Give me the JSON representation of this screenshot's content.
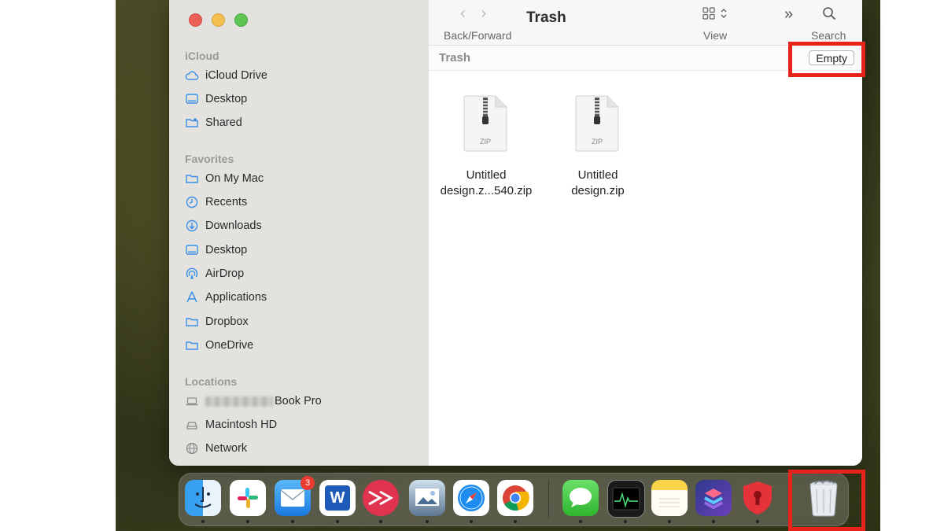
{
  "window": {
    "title": "Trash",
    "toolbar": {
      "back_forward_label": "Back/Forward",
      "view_label": "View",
      "search_label": "Search"
    },
    "pathbar": {
      "title": "Trash",
      "empty_label": "Empty"
    }
  },
  "sidebar": {
    "sections": {
      "icloud": "iCloud",
      "favorites": "Favorites",
      "locations": "Locations"
    },
    "icloud_items": [
      {
        "label": "iCloud Drive",
        "icon": "cloud-icon"
      },
      {
        "label": "Desktop",
        "icon": "desktop-icon"
      },
      {
        "label": "Shared",
        "icon": "shared-folder-icon"
      }
    ],
    "favorites_items": [
      {
        "label": "On My Mac",
        "icon": "folder-icon"
      },
      {
        "label": "Recents",
        "icon": "clock-icon"
      },
      {
        "label": "Downloads",
        "icon": "download-icon"
      },
      {
        "label": "Desktop",
        "icon": "desktop-icon"
      },
      {
        "label": "AirDrop",
        "icon": "airdrop-icon"
      },
      {
        "label": "Applications",
        "icon": "applications-icon"
      },
      {
        "label": "Dropbox",
        "icon": "folder-icon"
      },
      {
        "label": "OneDrive",
        "icon": "folder-icon"
      }
    ],
    "locations_items": [
      {
        "label": "Book Pro",
        "icon": "laptop-icon"
      },
      {
        "label": "Macintosh HD",
        "icon": "disk-icon"
      },
      {
        "label": "Network",
        "icon": "globe-icon"
      }
    ]
  },
  "files": [
    {
      "line1": "Untitled",
      "line2": "design.z...540.zip",
      "type_label": "ZIP"
    },
    {
      "line1": "Untitled",
      "line2": "design.zip",
      "type_label": "ZIP"
    }
  ],
  "dock": {
    "mail_badge": "3",
    "word_letter": "W"
  },
  "colors": {
    "highlight": "#e8231c",
    "sidebar_bg": "#e3e2df",
    "sidebar_icon": "#3b8ee8"
  }
}
